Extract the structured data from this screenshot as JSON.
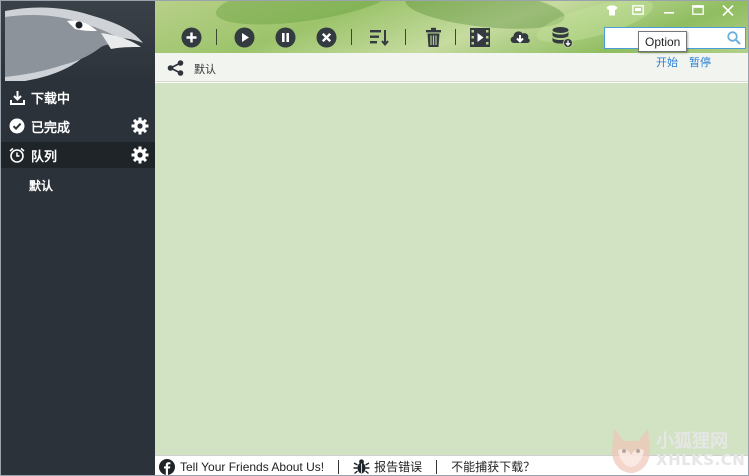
{
  "sidebar": {
    "nav": [
      {
        "label": "下载中",
        "icon": "download-icon"
      },
      {
        "label": "已完成",
        "icon": "check-circle-icon"
      },
      {
        "label": "队列",
        "icon": "alarm-clock-icon"
      }
    ],
    "queue_items": [
      "默认"
    ]
  },
  "toolbar": {
    "buttons": [
      {
        "name": "add",
        "icon": "plus-circle-icon"
      },
      {
        "name": "start",
        "icon": "play-circle-icon"
      },
      {
        "name": "pause",
        "icon": "pause-circle-icon"
      },
      {
        "name": "stop",
        "icon": "x-circle-icon"
      },
      {
        "name": "sort",
        "icon": "sort-icon"
      },
      {
        "name": "delete",
        "icon": "trash-icon"
      },
      {
        "name": "video",
        "icon": "film-icon"
      },
      {
        "name": "cloud-download",
        "icon": "cloud-download-icon"
      },
      {
        "name": "database",
        "icon": "database-icon"
      }
    ]
  },
  "search": {
    "value": "",
    "tooltip": "Option"
  },
  "queue_bar": {
    "name": "默认",
    "start": "开始",
    "pause": "暂停"
  },
  "footer": {
    "tell_friends": "Tell Your Friends About Us!",
    "report_bug": "报告错误",
    "cannot_capture": "不能捕获下载？"
  },
  "watermark": {
    "line1": "小狐狸网",
    "line2": "XHLKS.CN"
  },
  "colors": {
    "sidebar_bg": "#2c3239",
    "content_bg": "#d1e3c2",
    "link": "#2b7fd4",
    "search_border": "#4a9fd8"
  }
}
